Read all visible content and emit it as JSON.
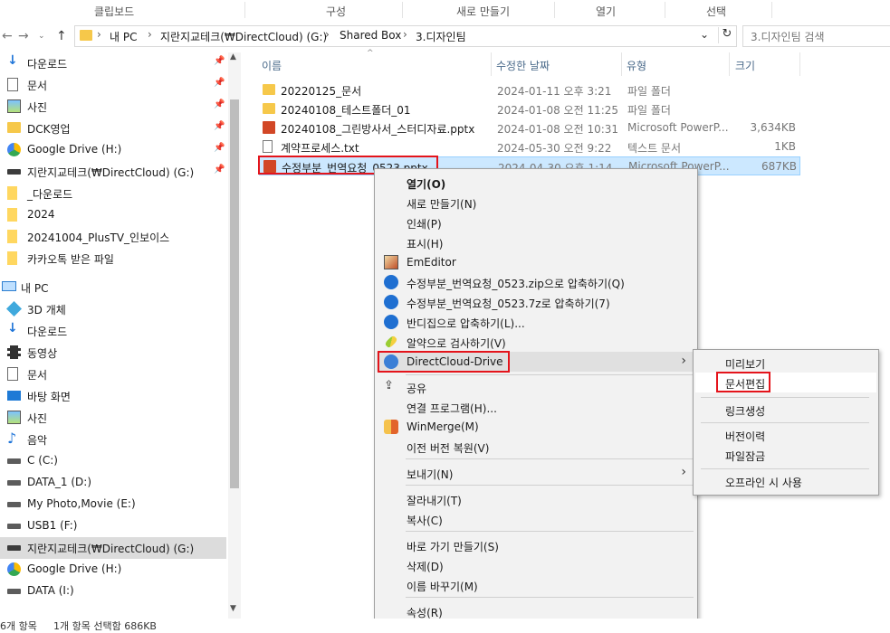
{
  "ribbon": {
    "groups": [
      "클립보드",
      "구성",
      "새로 만들기",
      "열기",
      "선택"
    ]
  },
  "address": {
    "crumbs": [
      "내 PC",
      "지란지교테크(₩DirectCloud) (G:)",
      "Shared Box",
      "3.디자인팀"
    ],
    "search_placeholder": "3.디자인팀 검색"
  },
  "nav": {
    "items": [
      {
        "label": "다운로드",
        "icon": "download-icon",
        "pinned": true
      },
      {
        "label": "문서",
        "icon": "document-icon",
        "pinned": true
      },
      {
        "label": "사진",
        "icon": "pictures-icon",
        "pinned": true
      },
      {
        "label": "DCK영업",
        "icon": "folder-icon",
        "pinned": true
      },
      {
        "label": "Google Drive (H:)",
        "icon": "google-drive-icon",
        "pinned": true
      },
      {
        "label": "지란지교테크(₩DirectCloud) (G:)",
        "icon": "network-drive-icon",
        "pinned": true
      },
      {
        "label": "_다운로드",
        "icon": "folder-icon",
        "pinned": false
      },
      {
        "label": "2024",
        "icon": "folder-icon",
        "pinned": false
      },
      {
        "label": "20241004_PlusTV_인보이스",
        "icon": "folder-icon",
        "pinned": false
      },
      {
        "label": "카카오톡 받은 파일",
        "icon": "folder-icon",
        "pinned": false
      },
      {
        "label": "내 PC",
        "icon": "pc-icon",
        "pinned": false
      },
      {
        "label": "3D 개체",
        "icon": "3d-objects-icon",
        "pinned": false
      },
      {
        "label": "다운로드",
        "icon": "download-icon",
        "pinned": false
      },
      {
        "label": "동영상",
        "icon": "video-icon",
        "pinned": false
      },
      {
        "label": "문서",
        "icon": "document-icon",
        "pinned": false
      },
      {
        "label": "바탕 화면",
        "icon": "desktop-icon",
        "pinned": false
      },
      {
        "label": "사진",
        "icon": "pictures-icon",
        "pinned": false
      },
      {
        "label": "음악",
        "icon": "music-icon",
        "pinned": false
      },
      {
        "label": "C (C:)",
        "icon": "drive-icon",
        "pinned": false
      },
      {
        "label": "DATA_1 (D:)",
        "icon": "drive-icon",
        "pinned": false
      },
      {
        "label": "My Photo,Movie (E:)",
        "icon": "drive-icon",
        "pinned": false
      },
      {
        "label": "USB1 (F:)",
        "icon": "drive-icon",
        "pinned": false
      },
      {
        "label": "지란지교테크(₩DirectCloud) (G:)",
        "icon": "network-drive-icon",
        "pinned": false
      },
      {
        "label": "Google Drive (H:)",
        "icon": "google-drive-icon",
        "pinned": false
      },
      {
        "label": "DATA (I:)",
        "icon": "drive-icon",
        "pinned": false
      }
    ]
  },
  "filelist": {
    "columns": [
      "이름",
      "수정한 날짜",
      "유형",
      "크기"
    ],
    "rows": [
      {
        "name": "20220125_문서",
        "date": "2024-01-11 오후 3:21",
        "type": "파일 폴더",
        "size": "",
        "icon": "folder-icon"
      },
      {
        "name": "20240108_테스트폴더_01",
        "date": "2024-01-08 오전 11:25",
        "type": "파일 폴더",
        "size": "",
        "icon": "folder-icon"
      },
      {
        "name": "20240108_그린방사서_스터디자료.pptx",
        "date": "2024-01-08 오전 10:31",
        "type": "Microsoft PowerP...",
        "size": "3,634KB",
        "icon": "powerpoint-icon"
      },
      {
        "name": "계약프로세스.txt",
        "date": "2024-05-30 오전 9:22",
        "type": "텍스트 문서",
        "size": "1KB",
        "icon": "text-file-icon"
      },
      {
        "name": "수정부분_번역요청_0523.pptx",
        "date": "2024-04-30 오후 1:14",
        "type": "Microsoft PowerP...",
        "size": "687KB",
        "icon": "powerpoint-icon"
      }
    ]
  },
  "context_menu": {
    "items": [
      "열기(O)",
      "새로 만들기(N)",
      "인쇄(P)",
      "표시(H)",
      "EmEditor",
      "수정부분_번역요청_0523.zip으로 압축하기(Q)",
      "수정부분_번역요청_0523.7z로 압축하기(7)",
      "반디집으로 압축하기(L)...",
      "알약으로 검사하기(V)",
      "DirectCloud-Drive",
      "공유",
      "연결 프로그램(H)...",
      "WinMerge(M)",
      "이전 버전 복원(V)",
      "보내기(N)",
      "잘라내기(T)",
      "복사(C)",
      "바로 가기 만들기(S)",
      "삭제(D)",
      "이름 바꾸기(M)",
      "속성(R)"
    ]
  },
  "submenu": {
    "items": [
      "미리보기",
      "문서편집",
      "링크생성",
      "버전이력",
      "파일잠금",
      "오프라인 시 사용"
    ]
  },
  "status": {
    "count": "6개 항목",
    "selection": "1개 항목 선택함 686KB"
  },
  "colors": {
    "selection": "#cce8ff",
    "highlight_box": "#e4141b",
    "folder": "#f6c84a"
  }
}
